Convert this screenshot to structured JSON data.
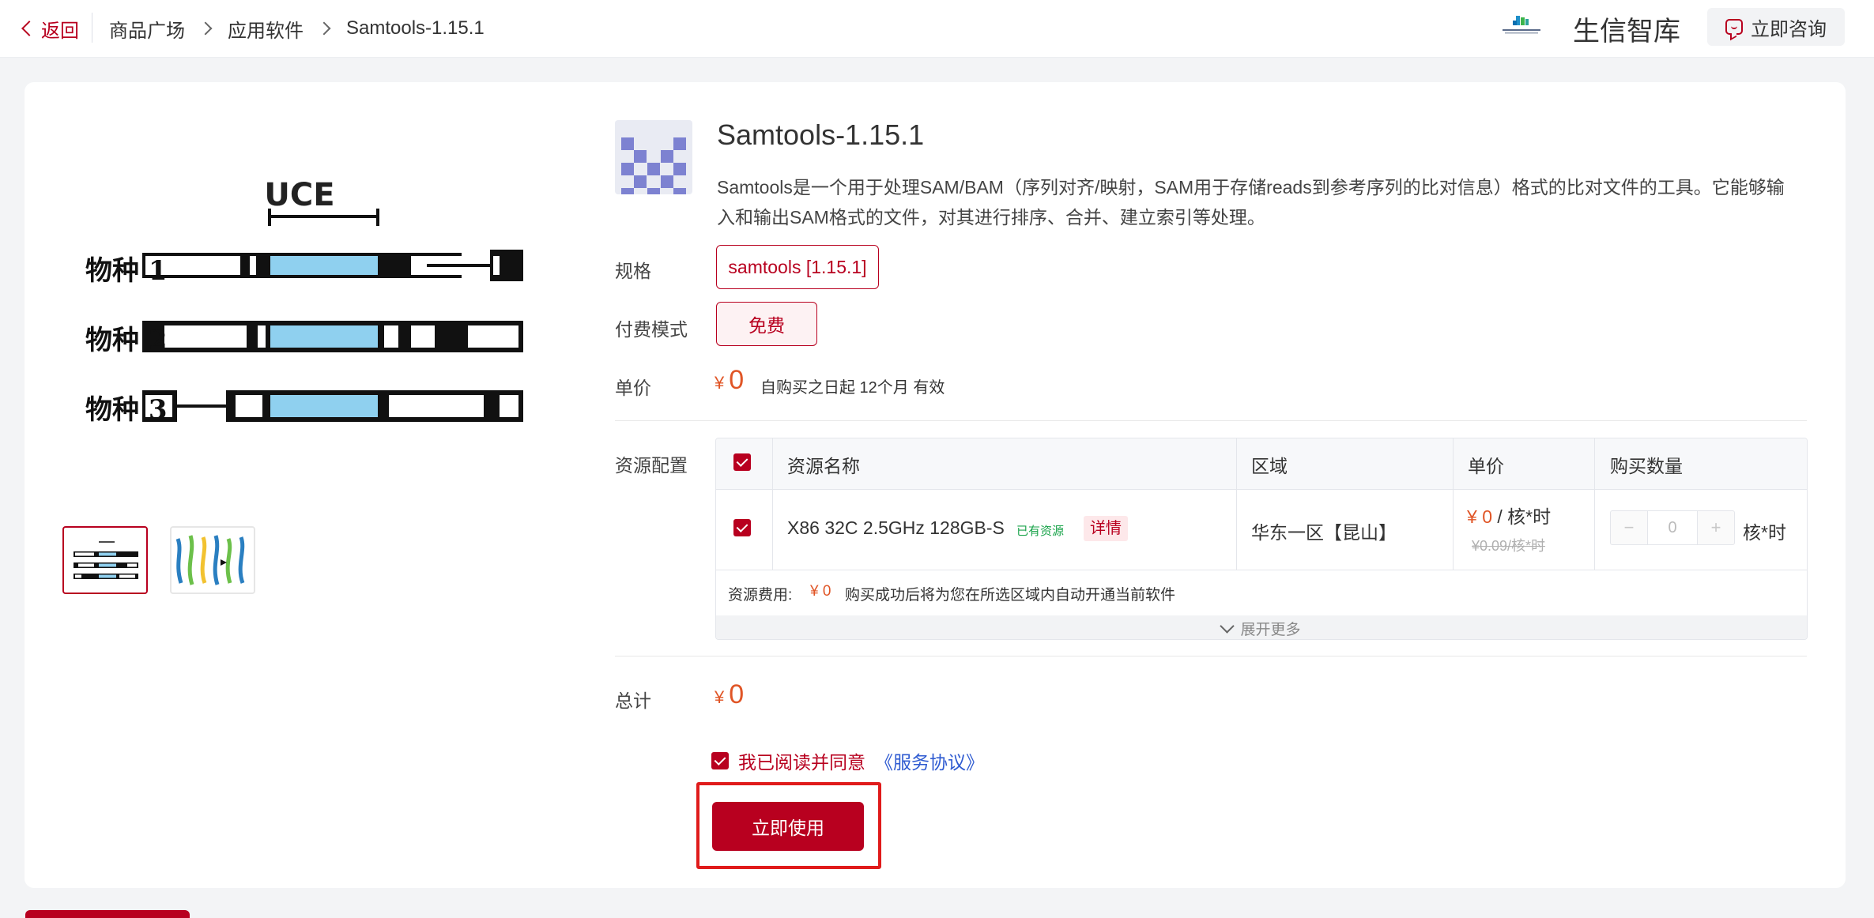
{
  "header": {
    "back_label": "返回",
    "breadcrumb": [
      "商品广场",
      "应用软件",
      "Samtools-1.15.1"
    ],
    "brand_name": "生信智库",
    "consult_label": "立即咨询"
  },
  "gallery": {
    "main_image": {
      "top_label": "UCE",
      "row_labels": [
        "物种 1",
        "物种 2",
        "物种 3"
      ]
    },
    "thumbnails": [
      "thumb-gene-alignment",
      "thumb-genome-art"
    ]
  },
  "product": {
    "title": "Samtools-1.15.1",
    "description": "Samtools是一个用于处理SAM/BAM（序列对齐/映射，SAM用于存储reads到参考序列的比对信息）格式的比对文件的工具。它能够输入和输出SAM格式的文件，对其进行排序、合并、建立索引等处理。",
    "spec_label": "规格",
    "spec_value": "samtools [1.15.1]",
    "payment_label": "付费模式",
    "payment_value": "免费",
    "unit_price_label": "单价",
    "currency_symbol": "¥",
    "unit_price": "0",
    "validity": "自购买之日起 12个月 有效"
  },
  "resources": {
    "label": "资源配置",
    "columns": [
      "资源名称",
      "区域",
      "单价",
      "购买数量"
    ],
    "row": {
      "checked": true,
      "name": "X86 32C 2.5GHz 128GB-S",
      "owned_badge": "已有资源",
      "detail_label": "详情",
      "region": "华东一区【昆山】",
      "price_symbol": "¥",
      "price_value": "0",
      "price_unit": "/ 核*时",
      "original_price": "¥0.09/核*时",
      "quantity": "0",
      "quantity_unit": "核*时"
    },
    "fee_label": "资源费用:",
    "fee_value": "¥ 0",
    "fee_note": "购买成功后将为您在所选区域内自动开通当前软件",
    "expand_label": "展开更多"
  },
  "total": {
    "label": "总计",
    "currency_symbol": "¥",
    "value": "0"
  },
  "agreement": {
    "checked": true,
    "text": "我已阅读并同意",
    "link": "《服务协议》"
  },
  "cta": {
    "label": "立即使用"
  },
  "colors": {
    "brand_red": "#b8001f",
    "price_orange": "#e05526",
    "link_blue": "#2f5bd1",
    "owned_green": "#19a34a",
    "highlight_red": "#e01b1b"
  }
}
